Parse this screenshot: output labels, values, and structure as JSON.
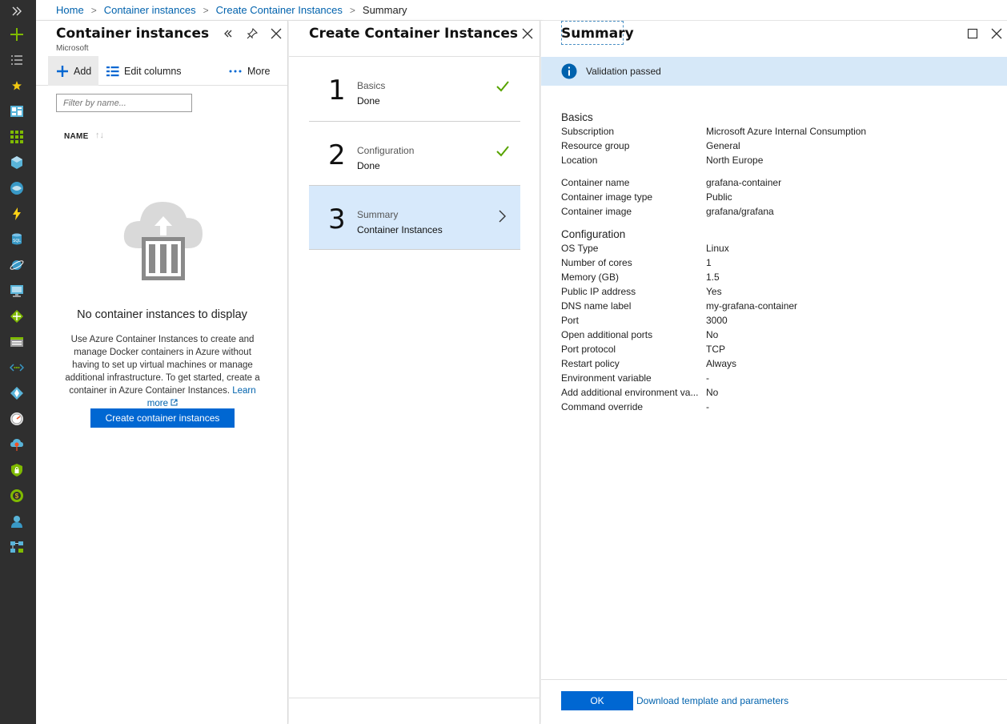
{
  "breadcrumb": {
    "items": [
      "Home",
      "Container instances",
      "Create Container Instances"
    ],
    "current": "Summary"
  },
  "nav": {
    "expand_icon": "chevron-double-right-icon",
    "items": [
      "create-resource-icon",
      "all-services-icon",
      "favorites-star-icon",
      "dashboard-icon",
      "all-resources-icon",
      "resource-groups-icon",
      "app-services-icon",
      "function-apps-icon",
      "sql-databases-icon",
      "cosmos-db-icon",
      "virtual-machines-icon",
      "load-balancers-icon",
      "storage-accounts-icon",
      "virtual-networks-icon",
      "azure-ad-icon",
      "monitor-icon",
      "advisor-icon",
      "security-center-icon",
      "cost-management-icon",
      "help-support-icon",
      "more-services-icon"
    ]
  },
  "blade1": {
    "title": "Container instances",
    "subtitle": "Microsoft",
    "toolbar": {
      "add": "Add",
      "edit_columns": "Edit columns",
      "more": "More"
    },
    "filter_placeholder": "Filter by name...",
    "column_name": "NAME",
    "empty_title": "No container instances to display",
    "empty_desc": "Use Azure Container Instances to create and manage Docker containers in Azure without having to set up virtual machines or manage additional infrastructure. To get started, create a container in Azure Container Instances.",
    "learn_more": "Learn more",
    "create_button": "Create container instances"
  },
  "blade2": {
    "title": "Create Container Instances",
    "steps": [
      {
        "num": "1",
        "title": "Basics",
        "status": "Done"
      },
      {
        "num": "2",
        "title": "Configuration",
        "status": "Done"
      },
      {
        "num": "3",
        "title": "Summary",
        "status": "Container Instances"
      }
    ]
  },
  "blade3": {
    "title": "Summary",
    "validation": "Validation passed",
    "basics_heading": "Basics",
    "basics": [
      {
        "key": "Subscription",
        "value": "Microsoft Azure Internal Consumption"
      },
      {
        "key": "Resource group",
        "value": "General"
      },
      {
        "key": "Location",
        "value": "North Europe"
      }
    ],
    "container": [
      {
        "key": "Container name",
        "value": "grafana-container"
      },
      {
        "key": "Container image type",
        "value": "Public"
      },
      {
        "key": "Container image",
        "value": "grafana/grafana"
      }
    ],
    "configuration_heading": "Configuration",
    "configuration": [
      {
        "key": "OS Type",
        "value": "Linux"
      },
      {
        "key": "Number of cores",
        "value": "1"
      },
      {
        "key": "Memory (GB)",
        "value": "1.5"
      },
      {
        "key": "Public IP address",
        "value": "Yes"
      },
      {
        "key": "DNS name label",
        "value": "my-grafana-container"
      },
      {
        "key": "Port",
        "value": "3000"
      },
      {
        "key": "Open additional ports",
        "value": "No"
      },
      {
        "key": "Port protocol",
        "value": "TCP"
      },
      {
        "key": "Restart policy",
        "value": "Always"
      },
      {
        "key": "Environment variable",
        "value": "-"
      },
      {
        "key": "Add additional environment va...",
        "value": "No"
      },
      {
        "key": "Command override",
        "value": "-"
      }
    ],
    "ok_button": "OK",
    "download_link": "Download template and parameters"
  },
  "colors": {
    "accent": "#0067d2",
    "link": "#0062ad",
    "rail": "#2f2f2f",
    "check": "#57a300",
    "selected_step": "#d7e9fb",
    "validation_bg": "#d6e8f8"
  }
}
